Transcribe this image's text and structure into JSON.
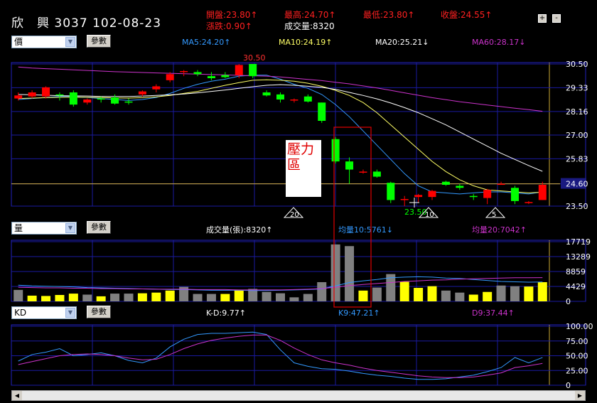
{
  "header": {
    "stock_name": "欣　興",
    "stock_code": "3037",
    "date": "102-08-23",
    "open": "開盤:23.80↑",
    "high": "最高:24.70↑",
    "low": "最低:23.80↑",
    "close": "收盤:24.55↑",
    "change": "漲跌:0.90↑",
    "volume": "成交量:8320",
    "plus_label": "+",
    "minus_label": "-"
  },
  "price_panel": {
    "select_value": "價",
    "param_button": "參數",
    "ma5": "MA5:24.20↑",
    "ma10": "MA10:24.19↑",
    "ma20": "MA20:25.21↓",
    "ma60": "MA60:28.17↓",
    "high_mark": "30.50",
    "low_mark": "23.50",
    "current_price": "24.60",
    "annotation": "壓力區",
    "period_markers": [
      "20",
      "10",
      "5"
    ]
  },
  "volume_panel": {
    "select_value": "量",
    "param_button": "參數",
    "volume_label": "成交量(張):8320↑",
    "avg10": "均量10:5761↓",
    "avg20": "均量20:7042↑"
  },
  "kd_panel": {
    "select_value": "KD",
    "param_button": "參數",
    "kd": "K-D:9.77↑",
    "k9": "K9:47.21↑",
    "d9": "D9:37.44↑"
  },
  "colors": {
    "up": "#ff0000",
    "down": "#00ff00",
    "ma5": "#3399ff",
    "ma10": "#ffff66",
    "ma20": "#ffffff",
    "ma60": "#cc33cc",
    "grid": "#1a1aa0",
    "vol_up": "#ffff00",
    "vol_down": "#808080"
  },
  "chart_data": [
    {
      "type": "candlestick",
      "title": "",
      "ylim": [
        23.5,
        30.5
      ],
      "yticks": [
        "30.50",
        "29.33",
        "28.16",
        "27.00",
        "25.83",
        "24.60",
        "23.50"
      ],
      "candles": [
        {
          "o": 28.8,
          "h": 29.1,
          "l": 28.7,
          "c": 28.95
        },
        {
          "o": 28.9,
          "h": 29.2,
          "l": 28.8,
          "c": 29.1
        },
        {
          "o": 28.9,
          "h": 29.4,
          "l": 28.8,
          "c": 29.35
        },
        {
          "o": 29.0,
          "h": 29.1,
          "l": 28.7,
          "c": 28.95
        },
        {
          "o": 29.1,
          "h": 29.2,
          "l": 28.4,
          "c": 28.5
        },
        {
          "o": 28.6,
          "h": 28.8,
          "l": 28.5,
          "c": 28.75
        },
        {
          "o": 28.8,
          "h": 28.9,
          "l": 28.6,
          "c": 28.75
        },
        {
          "o": 28.85,
          "h": 29.0,
          "l": 28.5,
          "c": 28.55
        },
        {
          "o": 28.65,
          "h": 28.8,
          "l": 28.5,
          "c": 28.6
        },
        {
          "o": 29.0,
          "h": 29.2,
          "l": 28.9,
          "c": 29.15
        },
        {
          "o": 29.25,
          "h": 29.5,
          "l": 29.1,
          "c": 29.4
        },
        {
          "o": 29.7,
          "h": 30.1,
          "l": 29.6,
          "c": 30.0
        },
        {
          "o": 30.1,
          "h": 30.2,
          "l": 29.9,
          "c": 30.15
        },
        {
          "o": 30.1,
          "h": 30.2,
          "l": 29.9,
          "c": 30.0
        },
        {
          "o": 29.9,
          "h": 30.1,
          "l": 29.7,
          "c": 29.8
        },
        {
          "o": 29.95,
          "h": 30.1,
          "l": 29.8,
          "c": 29.85
        },
        {
          "o": 29.95,
          "h": 30.5,
          "l": 29.8,
          "c": 30.45
        },
        {
          "o": 30.5,
          "h": 30.5,
          "l": 29.8,
          "c": 29.9
        },
        {
          "o": 29.1,
          "h": 29.2,
          "l": 28.9,
          "c": 28.95
        },
        {
          "o": 29.0,
          "h": 29.1,
          "l": 28.6,
          "c": 28.75
        },
        {
          "o": 28.7,
          "h": 28.8,
          "l": 28.6,
          "c": 28.75
        },
        {
          "o": 28.9,
          "h": 29.0,
          "l": 28.6,
          "c": 28.65
        },
        {
          "o": 28.6,
          "h": 28.6,
          "l": 27.6,
          "c": 27.7
        },
        {
          "o": 26.8,
          "h": 26.9,
          "l": 25.6,
          "c": 25.7
        },
        {
          "o": 25.7,
          "h": 25.9,
          "l": 24.6,
          "c": 25.3
        },
        {
          "o": 25.2,
          "h": 25.3,
          "l": 25.1,
          "c": 25.2
        },
        {
          "o": 25.2,
          "h": 25.3,
          "l": 24.9,
          "c": 24.95
        },
        {
          "o": 24.65,
          "h": 24.7,
          "l": 23.65,
          "c": 23.8
        },
        {
          "o": 23.85,
          "h": 24.0,
          "l": 23.5,
          "c": 23.85
        },
        {
          "o": 23.95,
          "h": 24.1,
          "l": 23.7,
          "c": 24.05
        },
        {
          "o": 23.95,
          "h": 24.3,
          "l": 23.8,
          "c": 24.25
        },
        {
          "o": 24.7,
          "h": 24.75,
          "l": 24.5,
          "c": 24.55
        },
        {
          "o": 24.5,
          "h": 24.6,
          "l": 24.3,
          "c": 24.4
        },
        {
          "o": 24.0,
          "h": 24.1,
          "l": 23.8,
          "c": 23.95
        },
        {
          "o": 23.9,
          "h": 24.35,
          "l": 23.6,
          "c": 24.3
        },
        {
          "o": 24.6,
          "h": 24.7,
          "l": 24.55,
          "c": 24.6
        },
        {
          "o": 24.4,
          "h": 24.5,
          "l": 23.6,
          "c": 23.75
        },
        {
          "o": 23.7,
          "h": 23.75,
          "l": 23.6,
          "c": 23.7
        },
        {
          "o": 23.8,
          "h": 24.7,
          "l": 23.8,
          "c": 24.55
        }
      ],
      "series": [
        {
          "name": "MA5",
          "values": [
            28.75,
            28.8,
            28.85,
            28.9,
            28.9,
            28.85,
            28.8,
            28.75,
            28.7,
            28.75,
            28.85,
            29.05,
            29.3,
            29.5,
            29.65,
            29.75,
            29.9,
            29.95,
            29.95,
            29.75,
            29.5,
            29.3,
            29.0,
            28.5,
            27.9,
            27.2,
            26.5,
            25.8,
            25.1,
            24.5,
            24.2,
            24.15,
            24.1,
            24.15,
            24.2,
            24.2,
            24.15,
            24.1,
            24.2
          ]
        },
        {
          "name": "MA10",
          "values": [
            28.8,
            28.82,
            28.84,
            28.86,
            28.87,
            28.86,
            28.85,
            28.83,
            28.82,
            28.84,
            28.88,
            28.95,
            29.05,
            29.15,
            29.3,
            29.45,
            29.58,
            29.7,
            29.72,
            29.7,
            29.65,
            29.55,
            29.4,
            29.2,
            28.95,
            28.6,
            28.1,
            27.5,
            26.9,
            26.3,
            25.7,
            25.2,
            24.8,
            24.5,
            24.3,
            24.25,
            24.2,
            24.15,
            24.19
          ]
        },
        {
          "name": "MA20",
          "values": [
            29.0,
            28.98,
            28.96,
            28.94,
            28.93,
            28.92,
            28.9,
            28.9,
            28.9,
            28.92,
            28.95,
            28.98,
            29.02,
            29.08,
            29.15,
            29.22,
            29.3,
            29.38,
            29.45,
            29.48,
            29.45,
            29.4,
            29.35,
            29.25,
            29.1,
            28.95,
            28.78,
            28.58,
            28.35,
            28.1,
            27.8,
            27.5,
            27.15,
            26.8,
            26.45,
            26.1,
            25.8,
            25.5,
            25.21
          ]
        },
        {
          "name": "MA60",
          "values": [
            30.35,
            30.3,
            30.27,
            30.24,
            30.21,
            30.18,
            30.15,
            30.12,
            30.1,
            30.08,
            30.06,
            30.04,
            30.02,
            30.0,
            29.98,
            29.96,
            29.94,
            29.92,
            29.9,
            29.86,
            29.8,
            29.74,
            29.68,
            29.6,
            29.52,
            29.42,
            29.32,
            29.2,
            29.08,
            28.96,
            28.84,
            28.74,
            28.64,
            28.56,
            28.48,
            28.4,
            28.32,
            28.25,
            28.17
          ]
        }
      ]
    },
    {
      "type": "bar",
      "title": "",
      "ylim": [
        0,
        17719
      ],
      "yticks": [
        "17719",
        "13289",
        "8859",
        "4429",
        "0"
      ],
      "values": [
        3400,
        1700,
        1600,
        1900,
        2300,
        2000,
        1500,
        2300,
        2300,
        2400,
        2600,
        3200,
        4300,
        2200,
        2200,
        2200,
        3400,
        3700,
        2800,
        2400,
        1200,
        2200,
        5700,
        16900,
        16400,
        3200,
        4100,
        8100,
        5800,
        4000,
        4500,
        3200,
        2600,
        2000,
        2800,
        4700,
        4500,
        4400,
        5700
      ],
      "up": [
        false,
        true,
        true,
        true,
        true,
        false,
        true,
        false,
        false,
        true,
        true,
        true,
        false,
        false,
        false,
        true,
        true,
        false,
        false,
        false,
        false,
        false,
        false,
        false,
        false,
        true,
        false,
        false,
        true,
        true,
        true,
        false,
        false,
        true,
        true,
        false,
        false,
        true,
        true
      ],
      "series": [
        {
          "name": "均量10",
          "values": [
            4800,
            4600,
            4500,
            4400,
            4300,
            4100,
            4000,
            3900,
            3800,
            3700,
            3600,
            3500,
            3500,
            3400,
            3300,
            3300,
            3300,
            3200,
            3200,
            3300,
            3400,
            3500,
            3700,
            4600,
            5600,
            6100,
            6500,
            7000,
            7200,
            7300,
            7200,
            6900,
            6800,
            6500,
            6200,
            5900,
            5800,
            5700,
            5761
          ]
        },
        {
          "name": "均量20",
          "values": [
            4200,
            4100,
            4000,
            4000,
            3900,
            3900,
            3800,
            3800,
            3700,
            3700,
            3600,
            3600,
            3600,
            3500,
            3500,
            3500,
            3400,
            3400,
            3400,
            3400,
            3500,
            3600,
            3800,
            4200,
            4700,
            5000,
            5300,
            5600,
            5900,
            6100,
            6300,
            6400,
            6600,
            6700,
            6800,
            6900,
            7000,
            7000,
            7042
          ]
        }
      ]
    },
    {
      "type": "line",
      "title": "",
      "ylim": [
        0,
        100
      ],
      "yticks": [
        "100.00",
        "75.00",
        "50.00",
        "25.00",
        "0"
      ],
      "series": [
        {
          "name": "K9",
          "values": [
            41,
            52,
            56,
            62,
            50,
            52,
            55,
            50,
            42,
            38,
            46,
            65,
            78,
            86,
            88,
            88,
            89,
            90,
            86,
            60,
            38,
            32,
            28,
            27,
            24,
            20,
            17,
            15,
            12,
            10,
            10,
            11,
            14,
            17,
            23,
            30,
            47,
            38,
            47
          ]
        },
        {
          "name": "D9",
          "values": [
            35,
            40,
            45,
            50,
            52,
            53,
            52,
            50,
            46,
            43,
            44,
            52,
            62,
            70,
            76,
            80,
            83,
            85,
            85,
            76,
            63,
            52,
            43,
            38,
            34,
            29,
            25,
            22,
            19,
            16,
            14,
            13,
            13,
            14,
            17,
            21,
            30,
            33,
            37
          ]
        }
      ]
    }
  ]
}
